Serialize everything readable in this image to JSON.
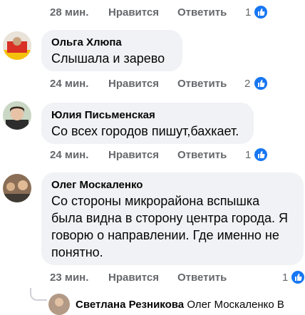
{
  "first_actions": {
    "time": "28 мин.",
    "like": "Нравится",
    "reply": "Ответить",
    "count": "1"
  },
  "comments": [
    {
      "author": "Ольга Хлюпа",
      "text": "Слышала и зарево",
      "time": "24 мин.",
      "like": "Нравится",
      "reply": "Ответить",
      "count": "2"
    },
    {
      "author": "Юлия Письменская",
      "text": "Со всех городов пишут,бахкает.",
      "time": "24 мин.",
      "like": "Нравится",
      "reply": "Ответить",
      "count": "1"
    },
    {
      "author": "Олег Москаленко",
      "text_lines": [
        "Со стороны микрорайона вспышка",
        "была видна в сторону центра города. Я",
        "говорю о направлении. Где именно не",
        "понятно."
      ],
      "time": "23 мин.",
      "like": "Нравится",
      "reply": "Ответить",
      "count": "1"
    }
  ],
  "reply_preview": {
    "author": "Светлана Резникова",
    "mention": "Олег Москаленко В"
  },
  "colors": {
    "bubble": "#f0f2f5",
    "meta_text": "#65676b",
    "like_blue": "#1877f2"
  }
}
